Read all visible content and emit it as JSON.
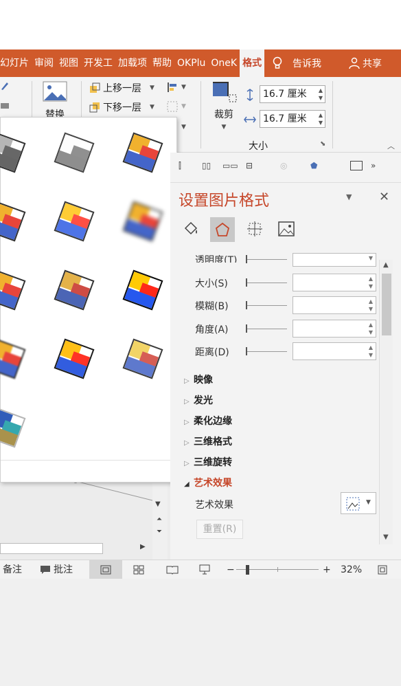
{
  "ribbon_tabs": [
    {
      "label": "幻灯片",
      "name": "tab-slideshow"
    },
    {
      "label": "审阅",
      "name": "tab-review"
    },
    {
      "label": "视图",
      "name": "tab-view"
    },
    {
      "label": "开发工",
      "name": "tab-developer"
    },
    {
      "label": "加载项",
      "name": "tab-addins"
    },
    {
      "label": "帮助",
      "name": "tab-help"
    },
    {
      "label": "OKPlu",
      "name": "tab-okplus"
    },
    {
      "label": "OneK",
      "name": "tab-onekey"
    },
    {
      "label": "格式",
      "name": "tab-format"
    }
  ],
  "tell_me": "告诉我",
  "share": "共享",
  "ribbon": {
    "replace": "替换",
    "bring_forward": "上移一层",
    "send_backward": "下移一层",
    "crop": "裁剪",
    "height_value": "16.7 厘米",
    "width_value": "16.7 厘米",
    "size_group": "大小"
  },
  "panel": {
    "title": "设置图片格式",
    "props": [
      {
        "label": "透明度(T)",
        "name": "transparency"
      },
      {
        "label": "大小(S)",
        "name": "size"
      },
      {
        "label": "模糊(B)",
        "name": "blur"
      },
      {
        "label": "角度(A)",
        "name": "angle"
      },
      {
        "label": "距离(D)",
        "name": "distance"
      }
    ],
    "sections": [
      {
        "label": "映像",
        "name": "reflection"
      },
      {
        "label": "发光",
        "name": "glow"
      },
      {
        "label": "柔化边缘",
        "name": "soft-edges"
      },
      {
        "label": "三维格式",
        "name": "3d-format"
      },
      {
        "label": "三维旋转",
        "name": "3d-rotation"
      }
    ],
    "art_effects_section": "艺术效果",
    "art_effects_label": "艺术效果",
    "reset": "重置(R)"
  },
  "status": {
    "notes": "备注",
    "comments": "批注",
    "zoom": "32%"
  },
  "colors": {
    "accent": "#d05a2b",
    "title": "#c6472a"
  }
}
